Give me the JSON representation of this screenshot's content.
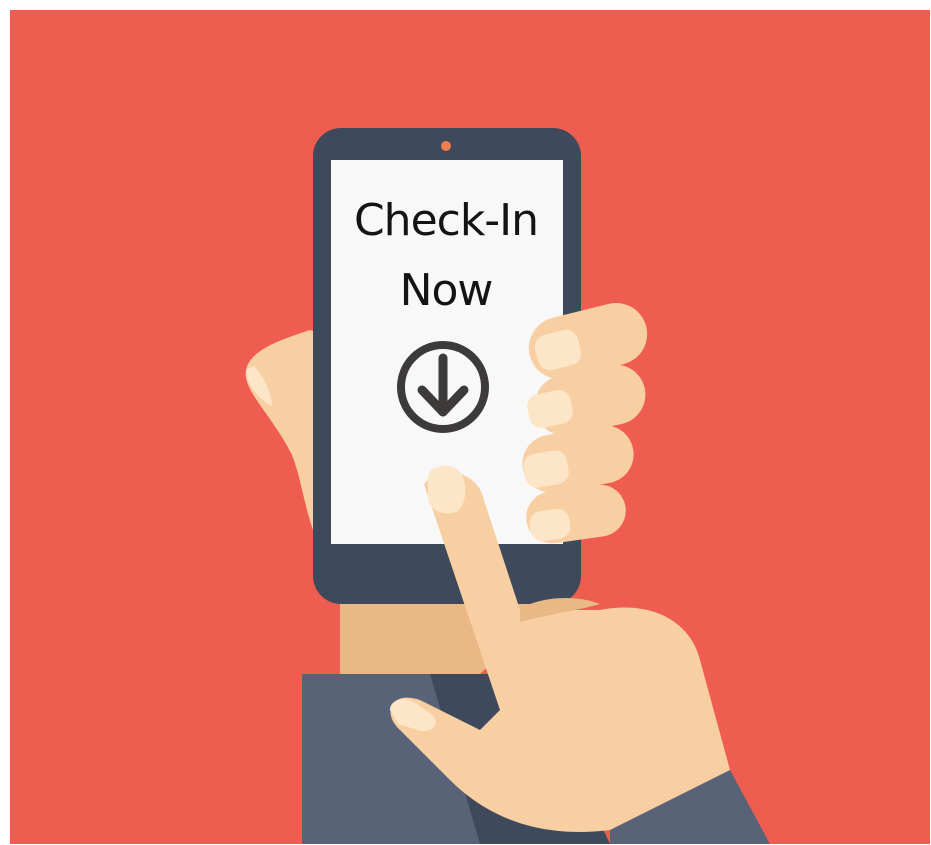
{
  "screen": {
    "line1": "Check-In",
    "line2": "Now",
    "button_icon": "arrow-down-circle-icon"
  },
  "colors": {
    "background": "#ef5d50",
    "phone_body": "#3e4a5c",
    "screen": "#f8f8f8",
    "skin": "#f7cfa3",
    "skin_shadow": "#e9b885",
    "sleeve": "#596377",
    "text": "#141414",
    "icon": "#3d3a3a"
  }
}
